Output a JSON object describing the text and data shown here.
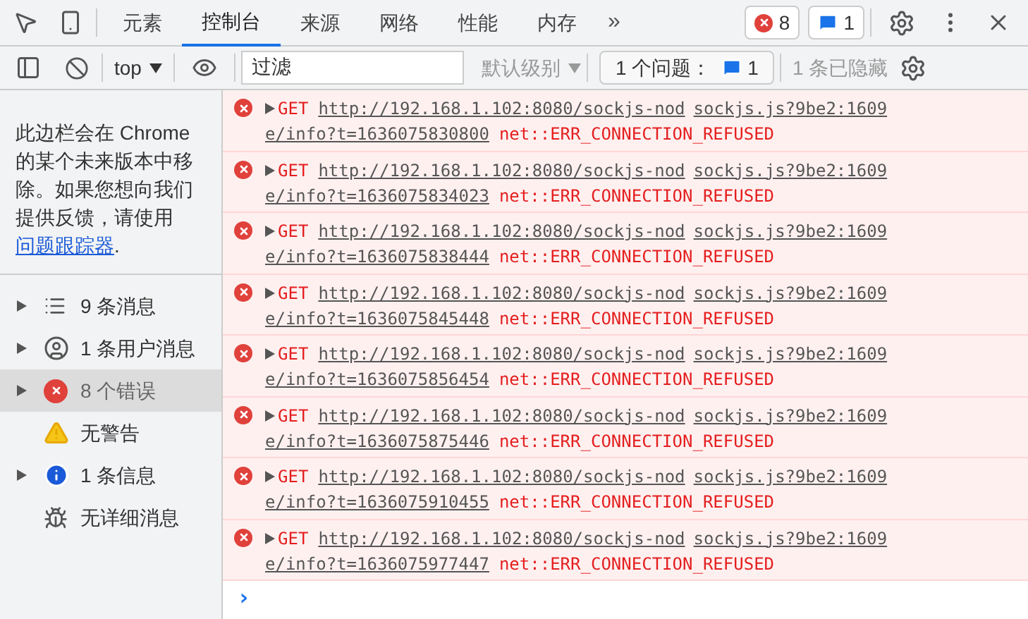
{
  "tabs": [
    {
      "label": "元素",
      "selected": false
    },
    {
      "label": "控制台",
      "selected": true
    },
    {
      "label": "来源",
      "selected": false
    },
    {
      "label": "网络",
      "selected": false
    },
    {
      "label": "性能",
      "selected": false
    },
    {
      "label": "内存",
      "selected": false
    }
  ],
  "more_tabs": "»",
  "error_count": "8",
  "issue_count": "1",
  "toolbar": {
    "context": "top",
    "filter": {
      "value": "过滤"
    },
    "levels": "默认级别",
    "issues_label": "1 个问题：",
    "issues_count": "1",
    "hidden": "1 条已隐藏"
  },
  "sidebar": {
    "notice": "此边栏会在 Chrome 的某个未来版本中移除。如果您想向我们提供反馈，请使用",
    "link": "问题跟踪器",
    "notice_end": ".",
    "items": [
      {
        "kind": "messages",
        "label": "9 条消息",
        "expandable": true,
        "selected": false
      },
      {
        "kind": "user",
        "label": "1 条用户消息",
        "expandable": true,
        "selected": false
      },
      {
        "kind": "error",
        "label": "8 个错误",
        "expandable": true,
        "selected": true
      },
      {
        "kind": "warning",
        "label": "无警告",
        "expandable": false,
        "selected": false
      },
      {
        "kind": "info",
        "label": "1 条信息",
        "expandable": true,
        "selected": false
      },
      {
        "kind": "verbose",
        "label": "无详细消息",
        "expandable": false,
        "selected": false
      }
    ]
  },
  "messages": [
    {
      "method": "GET",
      "url": [
        "http://192.168.1.102:8080/sockjs-nod",
        "e/info?t=1636075830800"
      ],
      "error": "net::ERR_CONNECTION_REFUSED",
      "source": "sockjs.js?9be2:1609"
    },
    {
      "method": "GET",
      "url": [
        "http://192.168.1.102:8080/sockjs-nod",
        "e/info?t=1636075834023"
      ],
      "error": "net::ERR_CONNECTION_REFUSED",
      "source": "sockjs.js?9be2:1609"
    },
    {
      "method": "GET",
      "url": [
        "http://192.168.1.102:8080/sockjs-nod",
        "e/info?t=1636075838444"
      ],
      "error": "net::ERR_CONNECTION_REFUSED",
      "source": "sockjs.js?9be2:1609"
    },
    {
      "method": "GET",
      "url": [
        "http://192.168.1.102:8080/sockjs-nod",
        "e/info?t=1636075845448"
      ],
      "error": "net::ERR_CONNECTION_REFUSED",
      "source": "sockjs.js?9be2:1609"
    },
    {
      "method": "GET",
      "url": [
        "http://192.168.1.102:8080/sockjs-nod",
        "e/info?t=1636075856454"
      ],
      "error": "net::ERR_CONNECTION_REFUSED",
      "source": "sockjs.js?9be2:1609"
    },
    {
      "method": "GET",
      "url": [
        "http://192.168.1.102:8080/sockjs-nod",
        "e/info?t=1636075875446"
      ],
      "error": "net::ERR_CONNECTION_REFUSED",
      "source": "sockjs.js?9be2:1609"
    },
    {
      "method": "GET",
      "url": [
        "http://192.168.1.102:8080/sockjs-nod",
        "e/info?t=1636075910455"
      ],
      "error": "net::ERR_CONNECTION_REFUSED",
      "source": "sockjs.js?9be2:1609"
    },
    {
      "method": "GET",
      "url": [
        "http://192.168.1.102:8080/sockjs-nod",
        "e/info?t=1636075977447"
      ],
      "error": "net::ERR_CONNECTION_REFUSED",
      "source": "sockjs.js?9be2:1609"
    }
  ],
  "prompt": "›"
}
